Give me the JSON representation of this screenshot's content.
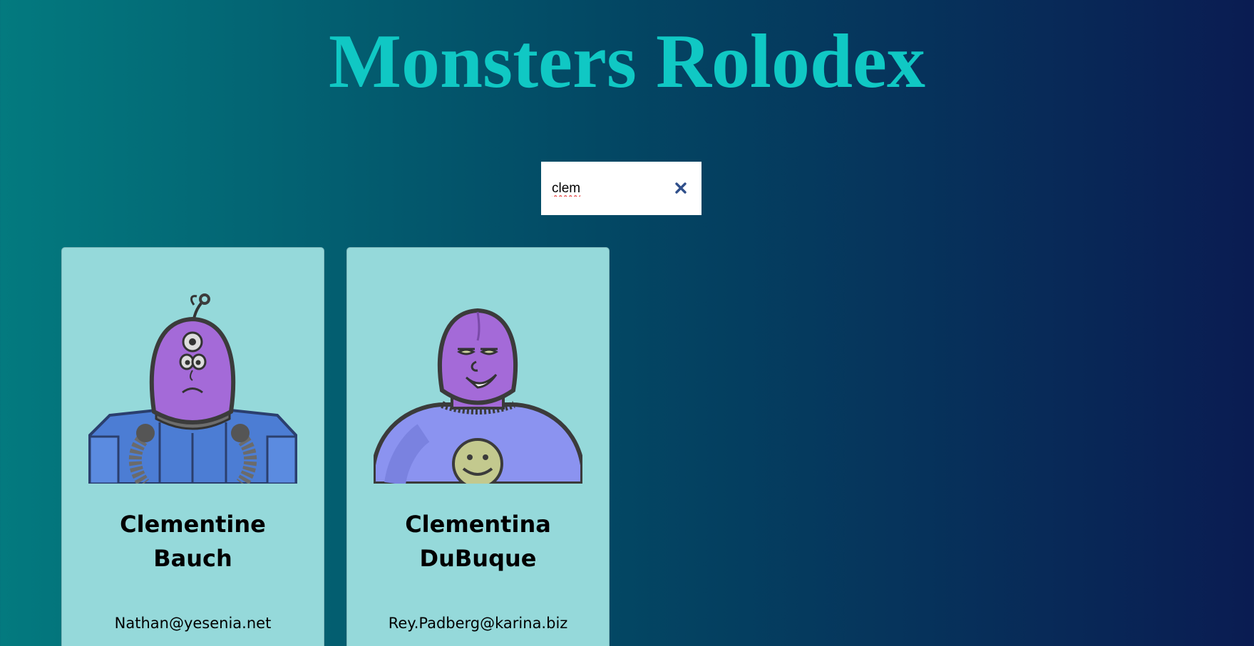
{
  "app": {
    "title": "Monsters Rolodex"
  },
  "search": {
    "value": "clem",
    "clear_icon": "close-icon"
  },
  "colors": {
    "title": "#10c8c4",
    "card_background": "#95d9da",
    "gradient_start": "#037a7f",
    "gradient_end": "#0a1c52"
  },
  "monsters": [
    {
      "name": "Clementine Bauch",
      "email": "Nathan@yesenia.net",
      "avatar": "robot-armored-monster-avatar"
    },
    {
      "name": "Clementina DuBuque",
      "email": "Rey.Padberg@karina.biz",
      "avatar": "smiley-shirt-monster-avatar"
    }
  ]
}
